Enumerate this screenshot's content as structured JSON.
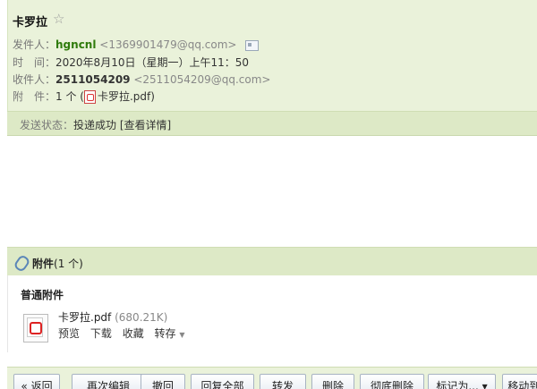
{
  "mail": {
    "subject": "卡罗拉",
    "star": "☆",
    "from": {
      "label": "发件人：",
      "name": "hgncnl",
      "email": "<1369901479@qq.com>"
    },
    "time": {
      "label": "时　间：",
      "value": "2020年8月10日（星期一）上午11：50"
    },
    "to": {
      "label": "收件人：",
      "name": "2511054209",
      "email": "<2511054209@qq.com>"
    },
    "attachment": {
      "label": "附　件：",
      "count": "1 个 (",
      "file": "卡罗拉.pdf",
      "close": ")"
    },
    "send_status": {
      "label": "发送状态：",
      "value": "投递成功",
      "details": "[查看详情]"
    }
  },
  "attachments": {
    "title": "附件",
    "count": "(1 个)",
    "group_label": "普通附件",
    "file": {
      "name": "卡罗拉.pdf",
      "size": "(680.21K)"
    },
    "actions": {
      "preview": "预览",
      "download": "下载",
      "collect": "收藏",
      "save_to": "转存"
    }
  },
  "toolbar": {
    "buttons": [
      "« 返回",
      "再次编辑",
      "撤回",
      "回复全部",
      "转发",
      "删除",
      "彻底删除",
      "标记为... ▾",
      "移动到..."
    ]
  }
}
